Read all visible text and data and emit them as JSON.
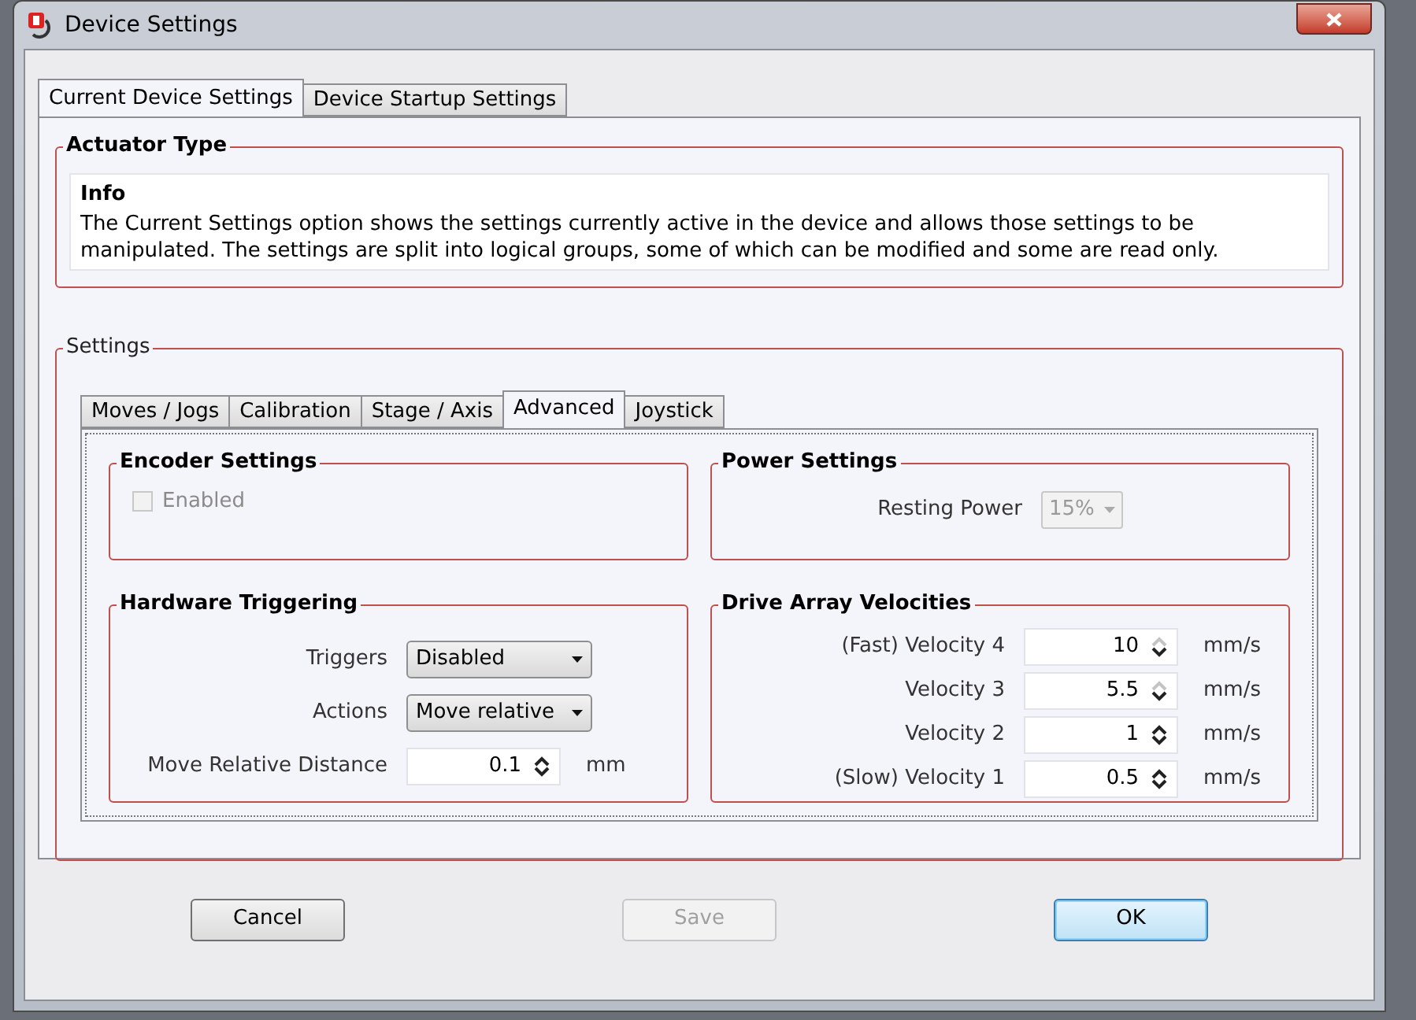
{
  "window": {
    "title": "Device Settings"
  },
  "tabs": [
    {
      "label": "Current Device Settings",
      "selected": true
    },
    {
      "label": "Device Startup Settings",
      "selected": false
    }
  ],
  "actuator_type": {
    "title": "Actuator Type",
    "info_title": "Info",
    "info_text": "The Current Settings option shows the settings currently active in the device and allows those settings to be manipulated. The settings are split into logical groups, some of which can be modified and some are read only."
  },
  "settings": {
    "title": "Settings",
    "tabs": [
      {
        "label": "Moves / Jogs",
        "selected": false
      },
      {
        "label": "Calibration",
        "selected": false
      },
      {
        "label": "Stage / Axis",
        "selected": false
      },
      {
        "label": "Advanced",
        "selected": true
      },
      {
        "label": "Joystick",
        "selected": false
      }
    ],
    "encoder": {
      "title": "Encoder Settings",
      "checkbox": {
        "label": "Enabled",
        "checked": false,
        "disabled": true
      }
    },
    "power": {
      "title": "Power Settings",
      "label": "Resting Power",
      "value": "15%",
      "disabled": true
    },
    "hardware_triggering": {
      "title": "Hardware Triggering",
      "rows": [
        {
          "kind": "dropdown",
          "label": "Triggers",
          "value": "Disabled"
        },
        {
          "kind": "dropdown",
          "label": "Actions",
          "value": "Move relative"
        },
        {
          "kind": "spinner",
          "label": "Move Relative Distance",
          "value": "0.1",
          "unit": "mm",
          "up_disabled": false
        }
      ]
    },
    "drive_array_velocities": {
      "title": "Drive Array Velocities",
      "rows": [
        {
          "kind": "spinner",
          "label": "(Fast) Velocity 4",
          "value": "10",
          "unit": "mm/s",
          "up_disabled": true
        },
        {
          "kind": "spinner",
          "label": "Velocity 3",
          "value": "5.5",
          "unit": "mm/s",
          "up_disabled": true
        },
        {
          "kind": "spinner",
          "label": "Velocity 2",
          "value": "1",
          "unit": "mm/s",
          "up_disabled": false
        },
        {
          "kind": "spinner",
          "label": "(Slow) Velocity 1",
          "value": "0.5",
          "unit": "mm/s",
          "up_disabled": false
        }
      ]
    }
  },
  "buttons": [
    {
      "label": "Cancel",
      "disabled": false,
      "default": false
    },
    {
      "label": "Save",
      "disabled": true,
      "default": false
    },
    {
      "label": "OK",
      "disabled": false,
      "default": true
    }
  ]
}
